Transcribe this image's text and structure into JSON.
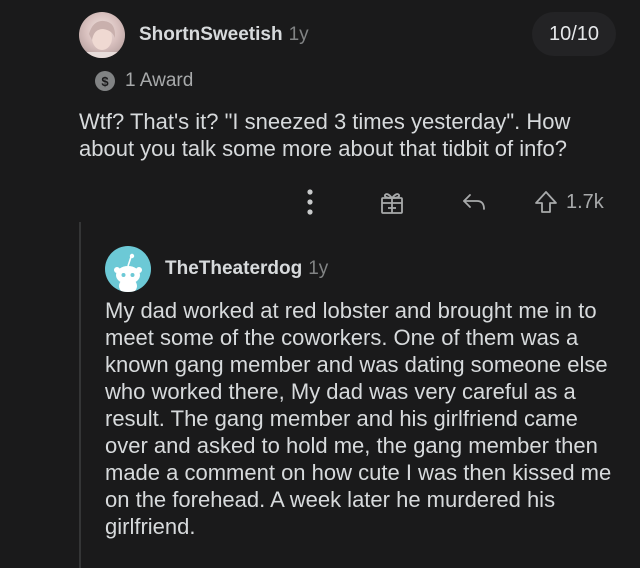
{
  "comment1": {
    "username": "ShortnSweetish",
    "age": "1y",
    "badge": "10/10",
    "award": {
      "icon": "award-coin-icon",
      "label": "1 Award"
    },
    "text": "Wtf? That's it? \"I sneezed 3 times yesterday\". How about you talk some more about that tidbit of info?"
  },
  "actions": {
    "icons": [
      "more-options-icon",
      "gift-icon",
      "reply-icon",
      "upvote-icon"
    ],
    "vote_count": "1.7k"
  },
  "comment2": {
    "username": "TheTheaterdog",
    "age": "1y",
    "text": "My dad worked at red lobster and brought me in to meet some of the coworkers. One of them was a known gang member and was dating someone else who worked there, My dad was very careful as a result. The gang member and his girlfriend came over and asked to hold me, the gang member then made a comment on how cute I was then kissed me on the forehead. A week later he murdered his girlfriend."
  },
  "colors": {
    "background": "#1a1a1b",
    "text": "#d7dadc",
    "muted": "#818384",
    "avatar2": "#6cc9d6"
  }
}
